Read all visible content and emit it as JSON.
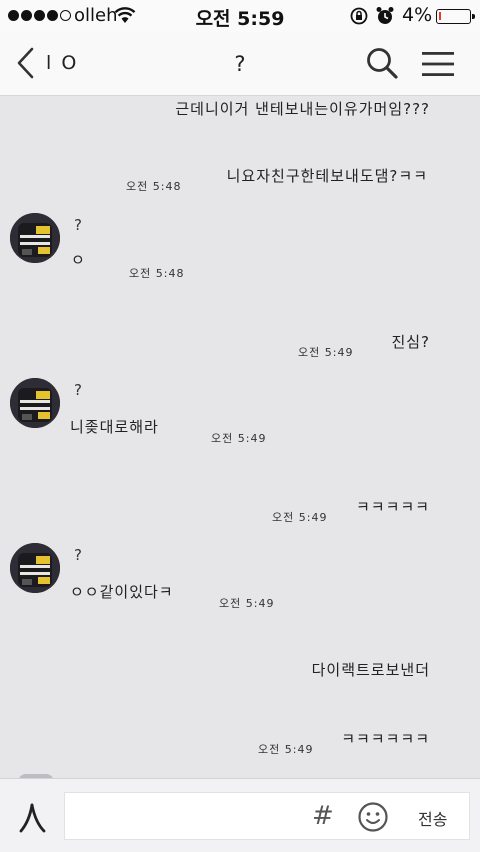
{
  "status_bar": {
    "carrier": "olleh",
    "time": "오전 5:59",
    "battery": "4%",
    "battery_level": 0.04,
    "signal_bars": 4,
    "signal_max": 5
  },
  "header": {
    "back_name": "l O",
    "title": "?"
  },
  "messages": [
    {
      "side": "right",
      "text": "근데니이거 낸테보내는이유가머임???"
    },
    {
      "side": "right",
      "text": "니요자친구한테보내도댐?ㅋㅋ",
      "time": "오전 5:48"
    },
    {
      "side": "left",
      "sender": "?",
      "text": "ㅇ",
      "time": "오전 5:48"
    },
    {
      "side": "right",
      "text": "진심?",
      "time": "오전 5:49"
    },
    {
      "side": "left",
      "sender": "?",
      "text": "니좆대로해라",
      "time": "오전 5:49"
    },
    {
      "side": "right",
      "text": "ㅋㅋㅋㅋㅋ",
      "time": "오전 5:49"
    },
    {
      "side": "left",
      "sender": "?",
      "text": "ㅇㅇ같이있다ㅋ",
      "time": "오전 5:49"
    },
    {
      "side": "right",
      "text": "다이랙트로보낸더"
    },
    {
      "side": "right",
      "text": "ㅋㅋㅋㅋㅋㅋ",
      "time": "오전 5:49"
    }
  ],
  "input_bar": {
    "send_label": "전송",
    "hash_label": "#"
  },
  "icons": {
    "back": "chevron-left-icon",
    "search": "search-icon",
    "menu": "hamburger-menu-icon",
    "attach": "attach-icon",
    "emoji": "emoji-icon"
  }
}
